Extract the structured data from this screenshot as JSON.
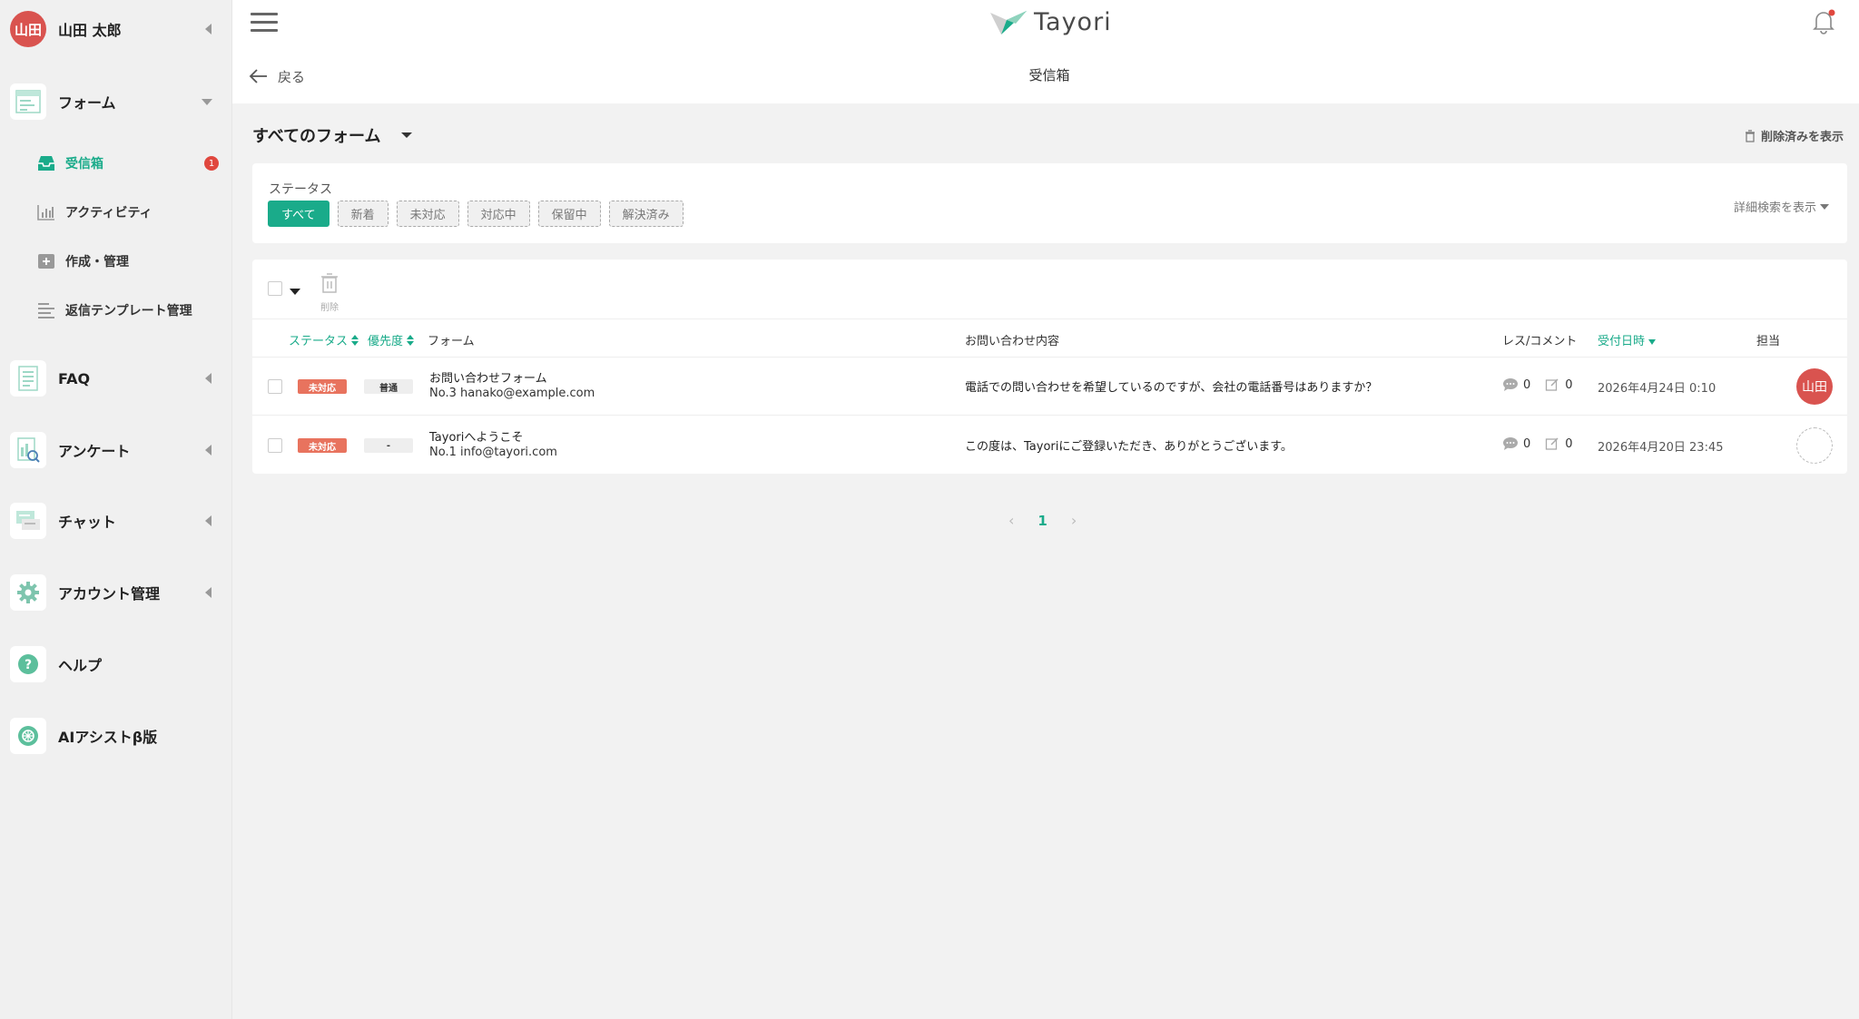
{
  "user": {
    "avatar_text": "山田",
    "name": "山田 太郎"
  },
  "sidebar": {
    "form": {
      "label": "フォーム"
    },
    "form_items": [
      {
        "label": "受信箱",
        "badge": "1"
      },
      {
        "label": "アクティビティ"
      },
      {
        "label": "作成・管理"
      },
      {
        "label": "返信テンプレート管理"
      }
    ],
    "faq": {
      "label": "FAQ"
    },
    "survey": {
      "label": "アンケート"
    },
    "chat": {
      "label": "チャット"
    },
    "account": {
      "label": "アカウント管理"
    },
    "help": {
      "label": "ヘルプ"
    },
    "ai": {
      "label": "AIアシストβ版"
    }
  },
  "header": {
    "logo_text": "Tayori",
    "back_label": "戻る",
    "page_title": "受信箱"
  },
  "main": {
    "form_selector": "すべてのフォーム",
    "show_deleted": "削除済みを表示",
    "filter": {
      "label": "ステータス",
      "buttons": [
        "すべて",
        "新着",
        "未対応",
        "対応中",
        "保留中",
        "解決済み"
      ],
      "advanced": "詳細検索を表示"
    },
    "toolbar": {
      "delete_label": "削除"
    },
    "columns": {
      "status": "ステータス",
      "priority": "優先度",
      "form": "フォーム",
      "content": "お問い合わせ内容",
      "res_comment": "レス/コメント",
      "date": "受付日時",
      "assignee": "担当"
    },
    "rows": [
      {
        "status": "未対応",
        "priority": "普通",
        "form_name": "お問い合わせフォーム",
        "form_sub": "No.3  hanako@example.com",
        "content": "電話での問い合わせを希望しているのですが、会社の電話番号はありますか？",
        "res_count": "0",
        "comment_count": "0",
        "date": "2026年4月24日 0:10",
        "assignee": "山田"
      },
      {
        "status": "未対応",
        "priority": "-",
        "form_name": "Tayoriへようこそ",
        "form_sub": "No.1  info@tayori.com",
        "content": "この度は、Tayoriにご登録いただき、ありがとうございます。",
        "res_count": "0",
        "comment_count": "0",
        "date": "2026年4月20日 23:45",
        "assignee": ""
      }
    ],
    "pagination": {
      "current": "1"
    }
  },
  "colors": {
    "accent": "#1aab8a",
    "danger": "#e0473e",
    "status_chip": "#e8735e",
    "avatar": "#d9534f"
  }
}
